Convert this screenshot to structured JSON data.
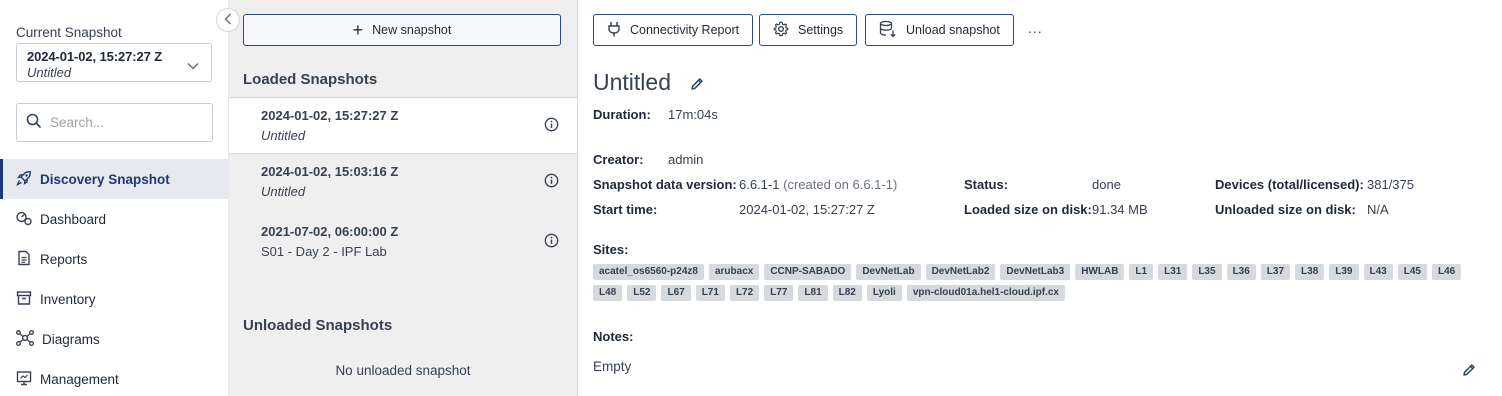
{
  "sidebar": {
    "current_snapshot_label": "Current Snapshot",
    "current_snapshot": {
      "date": "2024-01-02, 15:27:27 Z",
      "name": "Untitled"
    },
    "search_placeholder": "Search...",
    "nav": [
      {
        "label": "Discovery Snapshot",
        "icon": "rocket-icon",
        "active": true
      },
      {
        "label": "Dashboard",
        "icon": "dashboard-icon",
        "active": false
      },
      {
        "label": "Reports",
        "icon": "report-icon",
        "active": false
      },
      {
        "label": "Inventory",
        "icon": "inventory-icon",
        "active": false
      },
      {
        "label": "Diagrams",
        "icon": "diagram-icon",
        "active": false
      },
      {
        "label": "Management",
        "icon": "management-icon",
        "active": false
      }
    ]
  },
  "snapshots_panel": {
    "new_snapshot_label": "New snapshot",
    "loaded_title": "Loaded Snapshots",
    "loaded": [
      {
        "date": "2024-01-02, 15:27:27 Z",
        "name": "Untitled",
        "italic": true,
        "selected": true
      },
      {
        "date": "2024-01-02, 15:03:16 Z",
        "name": "Untitled",
        "italic": true,
        "selected": false
      },
      {
        "date": "2021-07-02, 06:00:00 Z",
        "name": "S01 - Day 2 - IPF Lab",
        "italic": false,
        "selected": false
      }
    ],
    "unloaded_title": "Unloaded Snapshots",
    "unloaded_empty": "No unloaded snapshot"
  },
  "toolbar": {
    "connectivity_label": "Connectivity Report",
    "settings_label": "Settings",
    "unload_label": "Unload snapshot",
    "more_label": "..."
  },
  "detail": {
    "title": "Untitled",
    "duration_label": "Duration:",
    "duration": "17m:04s",
    "creator_label": "Creator:",
    "creator": "admin",
    "version_label": "Snapshot data version:",
    "version": "6.6.1-1",
    "version_created": "(created on 6.6.1-1)",
    "start_label": "Start time:",
    "start": "2024-01-02, 15:27:27 Z",
    "status_label": "Status:",
    "status": "done",
    "loaded_size_label": "Loaded size on disk:",
    "loaded_size": "91.34 MB",
    "devices_label": "Devices (total/licensed):",
    "devices": "381/375",
    "unloaded_size_label": "Unloaded size on disk:",
    "unloaded_size": "N/A",
    "sites_label": "Sites:",
    "sites": [
      "acatel_os6560-p24z8",
      "arubacx",
      "CCNP-SABADO",
      "DevNetLab",
      "DevNetLab2",
      "DevNetLab3",
      "HWLAB",
      "L1",
      "L31",
      "L35",
      "L36",
      "L37",
      "L38",
      "L39",
      "L43",
      "L45",
      "L46",
      "L48",
      "L52",
      "L67",
      "L71",
      "L72",
      "L77",
      "L81",
      "L82",
      "Lyoli",
      "vpn-cloud01a.hel1-cloud.ipf.cx"
    ],
    "notes_label": "Notes:",
    "notes": "Empty"
  },
  "colors": {
    "accent": "#1e3a6e",
    "panel_bg": "#efefef",
    "tag_bg": "#d6d9dd"
  }
}
